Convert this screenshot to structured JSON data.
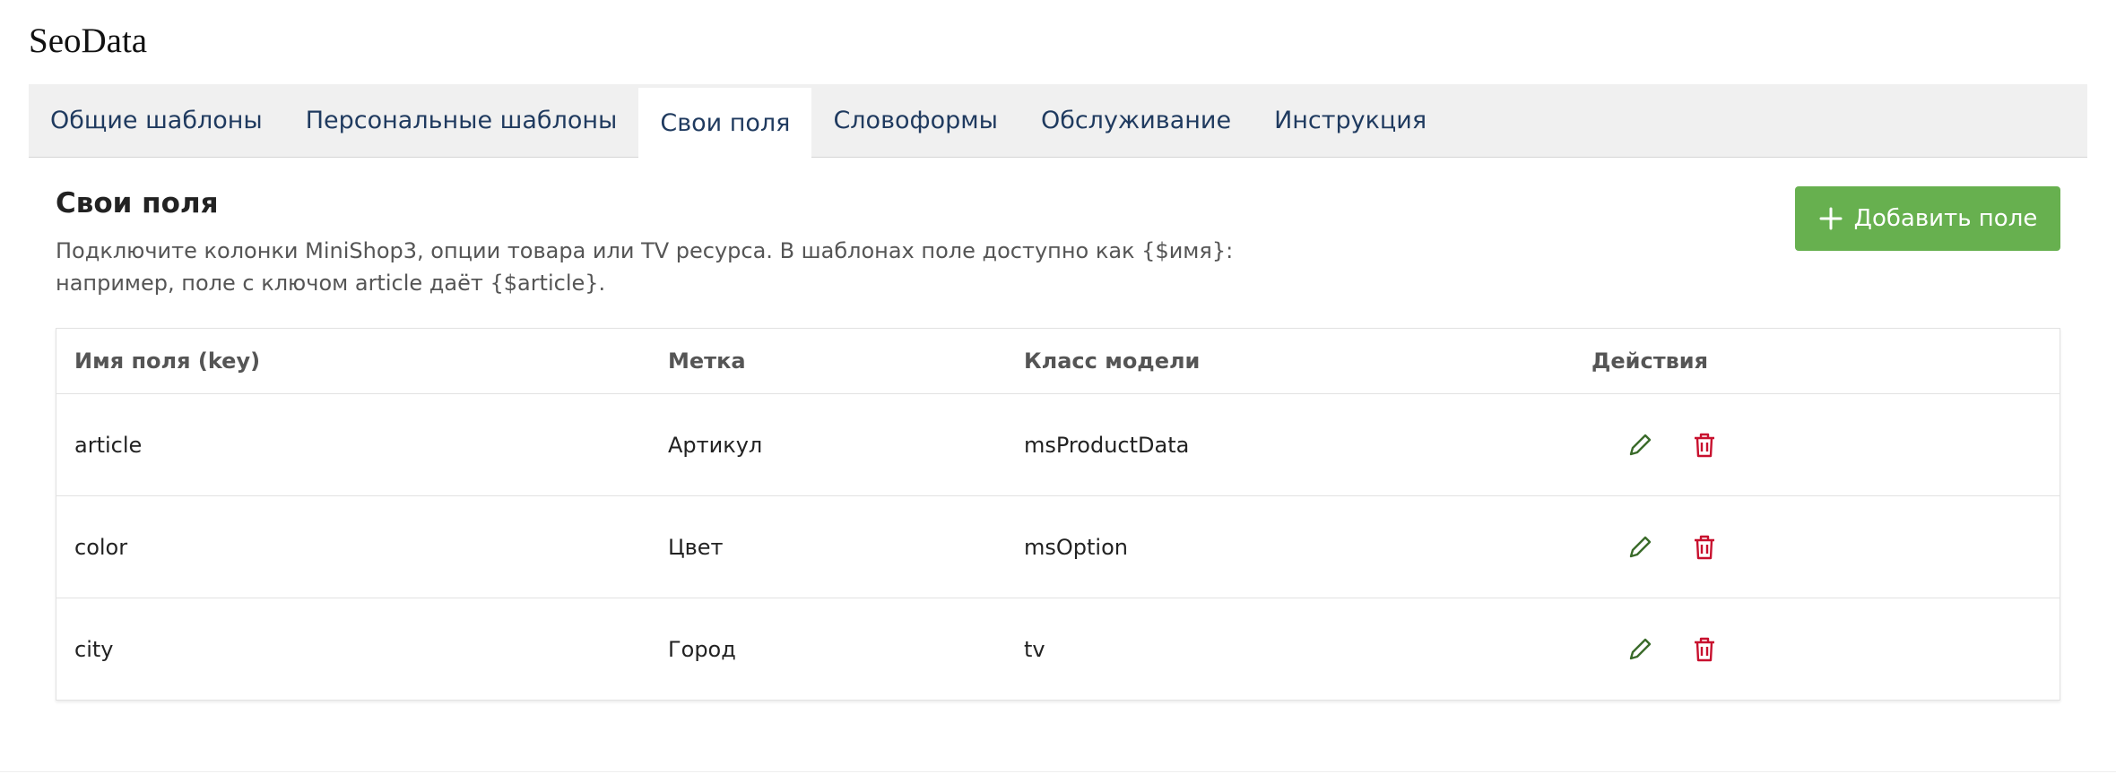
{
  "app": {
    "title": "SeoData"
  },
  "tabs": [
    {
      "label": "Общие шаблоны"
    },
    {
      "label": "Персональные шаблоны"
    },
    {
      "label": "Свои поля",
      "active": true
    },
    {
      "label": "Словоформы"
    },
    {
      "label": "Обслуживание"
    },
    {
      "label": "Инструкция"
    }
  ],
  "section": {
    "title": "Свои поля",
    "description_line1": "Подключите колонки MiniShop3, опции товара или TV ресурса. В шаблонах поле доступно как {$имя}:",
    "description_line2": "например, поле с ключом article даёт {$article}.",
    "add_button_label": "Добавить поле"
  },
  "table": {
    "headers": [
      "Имя поля (key)",
      "Метка",
      "Класс модели",
      "Действия"
    ],
    "rows": [
      {
        "key": "article",
        "label": "Артикул",
        "class": "msProductData"
      },
      {
        "key": "color",
        "label": "Цвет",
        "class": "msOption"
      },
      {
        "key": "city",
        "label": "Город",
        "class": "tv"
      }
    ]
  },
  "icons": {
    "add": "plus-icon",
    "edit": "pencil-icon",
    "delete": "trash-icon"
  },
  "colors": {
    "accent_green": "#67b04f",
    "edit_icon": "#3a6b2a",
    "delete_icon": "#c8102e",
    "tab_text": "#1f3a5f"
  }
}
